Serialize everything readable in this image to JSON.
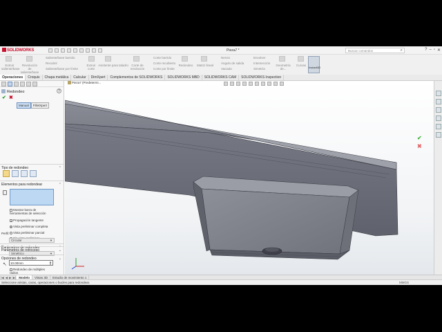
{
  "app": {
    "logo": "SOLIDWORKS",
    "document_title": "Pieza7 *",
    "search_placeholder": "Buscar comandos"
  },
  "ribbon": {
    "group1": [
      "Extruir saliente/base",
      "Revolución de saliente/base"
    ],
    "group2": [
      "Saliente/base barrido",
      "Recubrir",
      "Saliente/base por límite"
    ],
    "group3": [
      "Extruir corte",
      "Asistente para taladro",
      "Corte de revolución"
    ],
    "group4": [
      "Corte barrido",
      "Corte recubierto",
      "Corte por límite"
    ],
    "group5": [
      "Redondeo",
      "Matriz lineal"
    ],
    "group6": [
      "Nervio",
      "Ángulo de salida",
      "Vaciado"
    ],
    "group7": [
      "Envolver",
      "Intersección",
      "Simetría"
    ],
    "group8": [
      "Geometría de...",
      "Curvas"
    ],
    "instant3d": "Instant3D"
  },
  "tabs": [
    "Operaciones",
    "Croquis",
    "Chapa metálica",
    "Calcular",
    "DimXpert",
    "Complementos de SOLIDWORKS",
    "SOLIDWORKS MBD",
    "SOLIDWORKS CAM",
    "SOLIDWORKS Inspection"
  ],
  "panel": {
    "title": "Redondeo",
    "help": "?",
    "ok": "✔",
    "cancel": "✖",
    "mode_tabs": [
      "Manual",
      "FilletXpert"
    ],
    "section_type": "Tipo de redondeo",
    "section_items": "Elementos para redondear",
    "checks": {
      "toolbar": "Mostrar barra de herramientas de selección",
      "tangent": "Propagación tangente"
    },
    "radios": {
      "full": "Vista preliminar completa",
      "partial": "Vista preliminar parcial",
      "none": "Sin vista preliminar"
    },
    "section_params": "Parámetros de redondeo",
    "symmetric": "Simétrico",
    "radius": "10.00mm",
    "multi_radius": "Redondeo de múltiples radios",
    "profile_label": "Perfil:",
    "profile": "Circular",
    "section_setback": "Parámetros de retroceso",
    "section_options": "Opciones de redondeo"
  },
  "viewport": {
    "breadcrumb": "Pieza7 (Predetermi..."
  },
  "bottom_tabs": [
    "Modelo",
    "Vistas 3D",
    "Estudio de movimiento 1"
  ],
  "status": {
    "message": "Seleccione aristas, caras, operaciones o bucles para redondear.",
    "units": "MMGS"
  },
  "colors": {
    "accent": "#c8102e",
    "selection": "#bcd8f2",
    "model": "#6e7079"
  }
}
